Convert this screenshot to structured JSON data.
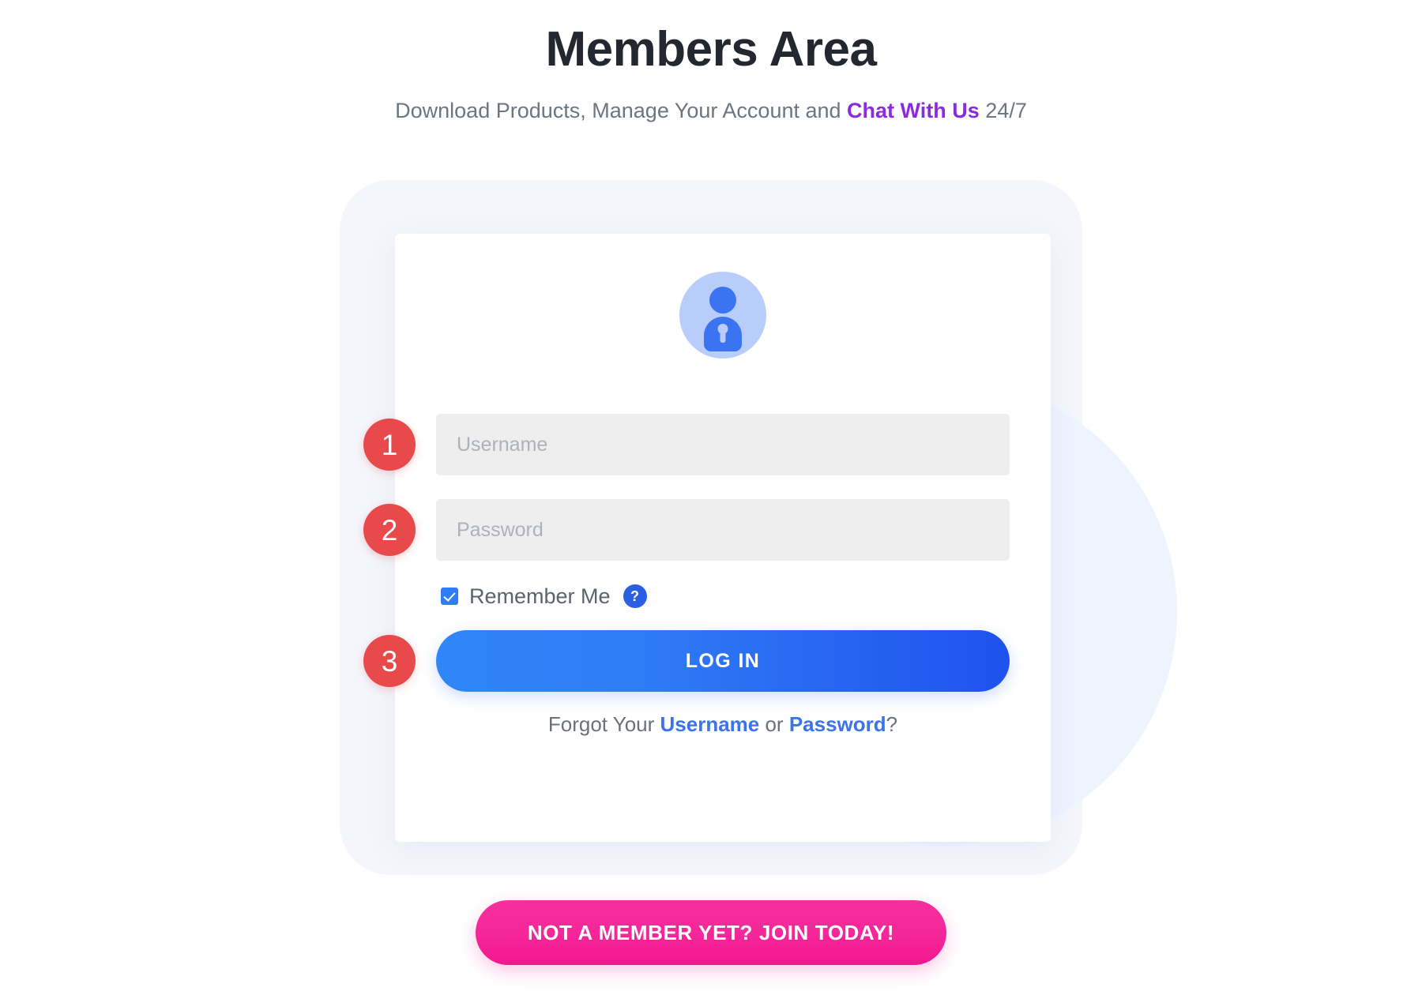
{
  "header": {
    "title": "Members Area",
    "subtitle_prefix": "Download Products, Manage Your Account and ",
    "subtitle_link": "Chat With Us",
    "subtitle_suffix": " 24/7"
  },
  "card": {
    "avatar_icon": "user-lock-avatar-icon",
    "fields": [
      {
        "name": "username",
        "placeholder": "Username",
        "value": "",
        "step": "1"
      },
      {
        "name": "password",
        "placeholder": "Password",
        "value": "",
        "step": "2"
      }
    ],
    "remember": {
      "label": "Remember Me",
      "checked": true,
      "help_icon": "?"
    },
    "login": {
      "label": "LOG IN",
      "step": "3"
    },
    "forgot": {
      "prefix": "Forgot Your ",
      "username_link": "Username",
      "middle": " or ",
      "password_link": "Password",
      "suffix": "?"
    }
  },
  "join": {
    "label": "NOT A MEMBER YET? JOIN TODAY!"
  },
  "colors": {
    "title": "#23272f",
    "subtitle": "#6d7580",
    "chat_link": "#8a2be2",
    "step_badge": "#e8494a",
    "login_gradient_start": "#2f86f6",
    "login_gradient_end": "#1f52ee",
    "join_pink": "#f5279a",
    "forgot_link": "#3a74e8",
    "avatar_bg": "#b9cdfb",
    "avatar_fg": "#3b74f0",
    "input_bg": "#eeeeee"
  }
}
